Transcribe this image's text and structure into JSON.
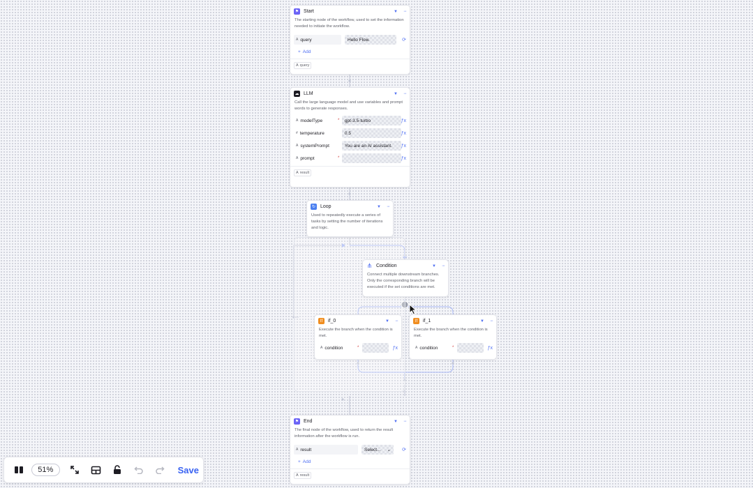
{
  "nodes": {
    "start": {
      "title": "Start",
      "description": "The starting node of the workflow, used to set the information needed to initiate the workflow.",
      "param_key": "query",
      "param_value": "Hello Flow.",
      "add_label": "Add",
      "output": "query"
    },
    "llm": {
      "title": "LLM",
      "description": "Call the large language model and use variables and prompt words to generate responses.",
      "params": [
        {
          "key": "modelType",
          "value": "gpt-3.5-turbo"
        },
        {
          "key": "temperature",
          "value": "0.5"
        },
        {
          "key": "systemPrompt",
          "value": "You are an AI assistant."
        },
        {
          "key": "prompt",
          "value": ""
        }
      ],
      "output": "result"
    },
    "loop": {
      "title": "Loop",
      "description": "Used to repeatedly execute a series of tasks by setting the number of iterations and logic."
    },
    "condition": {
      "title": "Condition",
      "description": "Connect multiple downstream branches. Only the corresponding branch will be executed if the set conditions are met."
    },
    "if0": {
      "title": "if_0",
      "description": "Execute the branch when the condition is met.",
      "param_key": "condition",
      "param_value": ""
    },
    "if1": {
      "title": "if_1",
      "description": "Execute the branch when the condition is met.",
      "param_key": "condition",
      "param_value": ""
    },
    "end": {
      "title": "End",
      "description": "The final node of the workflow, used to return the result information after the workflow is run.",
      "param_key": "result",
      "param_value": "Select...",
      "add_label": "Add",
      "output": "result"
    }
  },
  "toolbar": {
    "zoom": "51%",
    "save_label": "Save",
    "icons": [
      "minimap-icon",
      "fit-view-icon",
      "auto-layout-icon",
      "lock-icon",
      "undo-icon",
      "redo-icon"
    ]
  },
  "colors": {
    "accent": "#4e6ef2",
    "start_icon": "#6b63f6",
    "if_icon": "#f08d1f",
    "edge": "#c4c8d6",
    "edge_active": "#a9b8f5"
  }
}
